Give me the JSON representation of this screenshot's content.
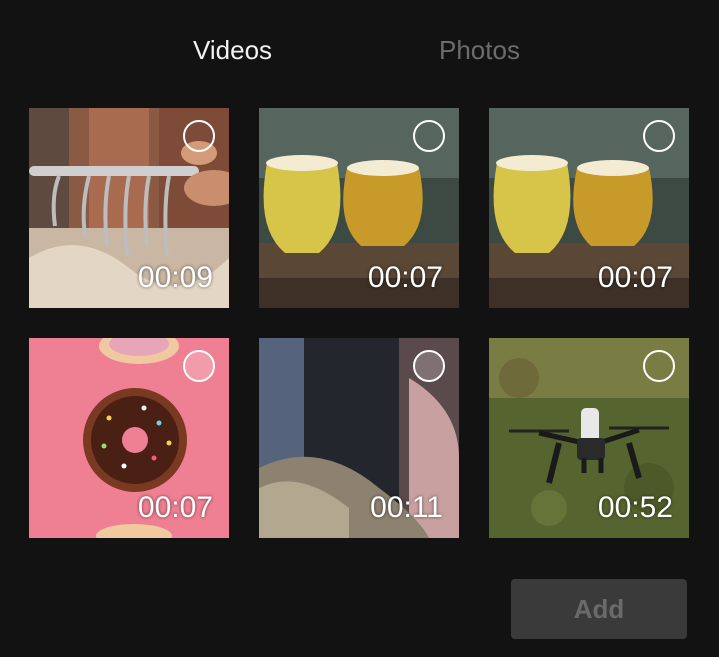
{
  "tabs": {
    "videos": "Videos",
    "photos": "Photos",
    "active": "videos"
  },
  "media": [
    {
      "duration": "00:09",
      "subject": "clothing rack"
    },
    {
      "duration": "00:07",
      "subject": "beer glasses"
    },
    {
      "duration": "00:07",
      "subject": "beer glasses"
    },
    {
      "duration": "00:07",
      "subject": "donuts"
    },
    {
      "duration": "00:11",
      "subject": "blurred scene"
    },
    {
      "duration": "00:52",
      "subject": "drone on grass"
    }
  ],
  "actions": {
    "add_label": "Add",
    "add_enabled": false
  },
  "colors": {
    "background": "#121212",
    "tab_active": "#f2f2f2",
    "tab_inactive": "#6c6c6c",
    "button_disabled_bg": "#3a3a3a",
    "button_disabled_text": "#6a6a6a"
  }
}
